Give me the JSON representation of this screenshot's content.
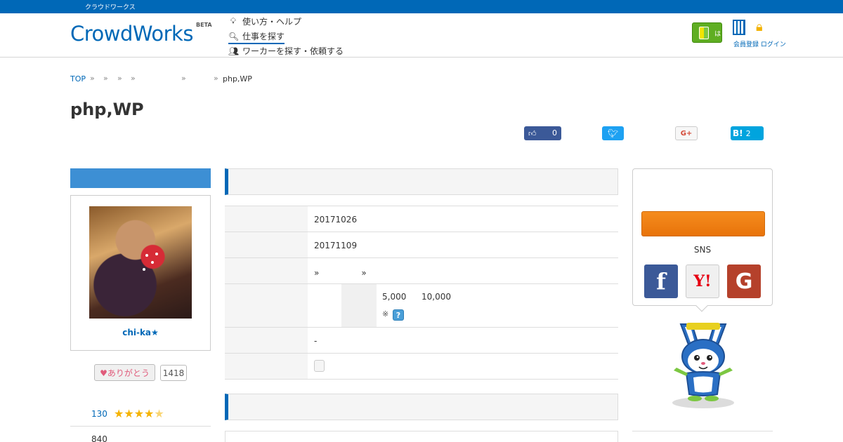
{
  "topbar": {
    "text": "クラウドワークス"
  },
  "header": {
    "logo": "CrowdWorks",
    "logo_badge": "BETA",
    "nav": [
      {
        "label": "使い方・ヘルプ",
        "icon": "lightbulb-icon"
      },
      {
        "label": "仕事を探す",
        "icon": "search-icon"
      },
      {
        "label": "ワーカーを探す・依頼する",
        "icon": "users-icon"
      }
    ],
    "beginner_label": "はじめての方",
    "account_links": "会員登録 ログイン"
  },
  "breadcrumb": {
    "top": "TOP",
    "separator": "»",
    "last": "php,WP"
  },
  "title": "php,WP",
  "share": {
    "facebook_count": "0",
    "hatena_label": "B!",
    "hatena_count": "2",
    "gplus_label": "G+"
  },
  "profile": {
    "username": "chi-ka★",
    "thanks_label": "♥ありがとう",
    "thanks_count": "1418",
    "rating_count": "130",
    "stars": "★★★★",
    "half_star": "★",
    "second_count": "840"
  },
  "details": {
    "posted_date": "20171026",
    "deadline": "20171109",
    "category": "»　　　　　»",
    "budget_min": "5,000",
    "budget_max": "10,000",
    "note_mark": "※",
    "help_mark": "?",
    "value_dash": "-"
  },
  "apply": {
    "sns_label": "SNS",
    "facebook": "f",
    "yahoo": "Y!",
    "google": "G"
  },
  "colors": {
    "brand": "#0068b7",
    "apply": "#f08020",
    "section_accent": "#0068b7"
  }
}
